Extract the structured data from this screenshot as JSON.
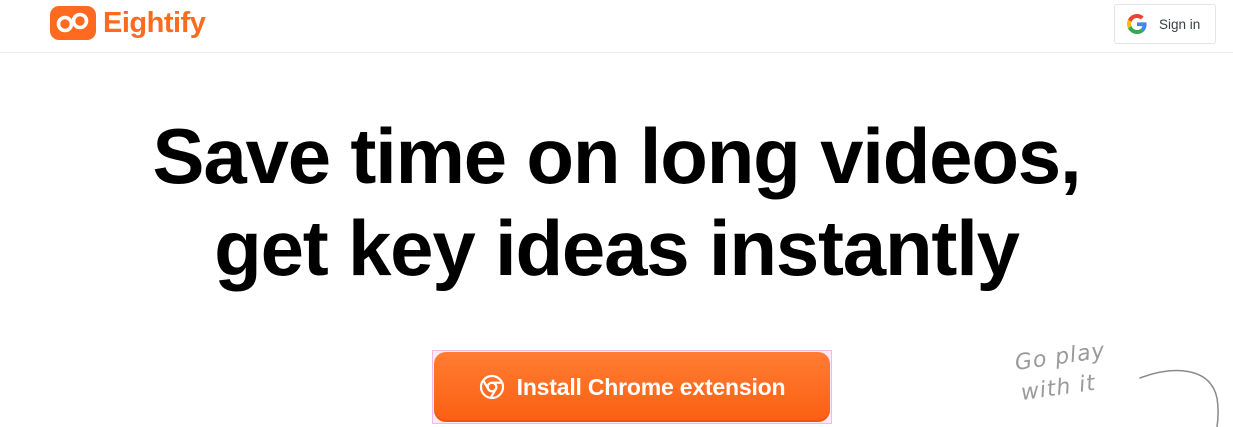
{
  "header": {
    "brand": "Eightify",
    "signin_label": "Sign in",
    "signin_icon": "google-g-icon",
    "brand_color": "#ff6a21"
  },
  "hero": {
    "headline_line1": "Save time on long videos,",
    "headline_line2": "get key ideas instantly",
    "cta_label": "Install Chrome extension",
    "cta_icon": "chrome-icon",
    "cta_color": "#fb5f12",
    "note_line1": "Go play",
    "note_line2": "with it"
  }
}
